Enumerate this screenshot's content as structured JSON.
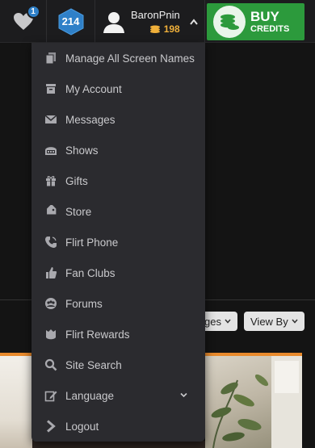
{
  "header": {
    "favorites_count": "1",
    "level_badge": "214",
    "username": "BaronPnin",
    "credits": "198",
    "buy_main": "BUY",
    "buy_sub": "CREDITS"
  },
  "menu": {
    "items": [
      {
        "label": "Manage All Screen Names",
        "icon": "screen-names-icon"
      },
      {
        "label": "My Account",
        "icon": "account-icon"
      },
      {
        "label": "Messages",
        "icon": "envelope-icon"
      },
      {
        "label": "Shows",
        "icon": "shows-icon"
      },
      {
        "label": "Gifts",
        "icon": "gift-icon"
      },
      {
        "label": "Store",
        "icon": "tag-icon"
      },
      {
        "label": "Flirt Phone",
        "icon": "phone-icon"
      },
      {
        "label": "Fan Clubs",
        "icon": "thumbs-up-icon"
      },
      {
        "label": "Forums",
        "icon": "forums-icon"
      },
      {
        "label": "Flirt Rewards",
        "icon": "rewards-icon"
      },
      {
        "label": "Site Search",
        "icon": "search-icon"
      },
      {
        "label": "Language",
        "icon": "edit-icon"
      },
      {
        "label": "Logout",
        "icon": "chevron-right-icon"
      }
    ]
  },
  "filters": {
    "partial_label": "ges",
    "view_by": "View By"
  },
  "colors": {
    "buy_green": "#2c9a3c",
    "credit_gold": "#f0b03a",
    "badge_blue": "#2f80c8",
    "menu_bg": "#2b2b2f",
    "accent_orange": "#e98a2c"
  }
}
